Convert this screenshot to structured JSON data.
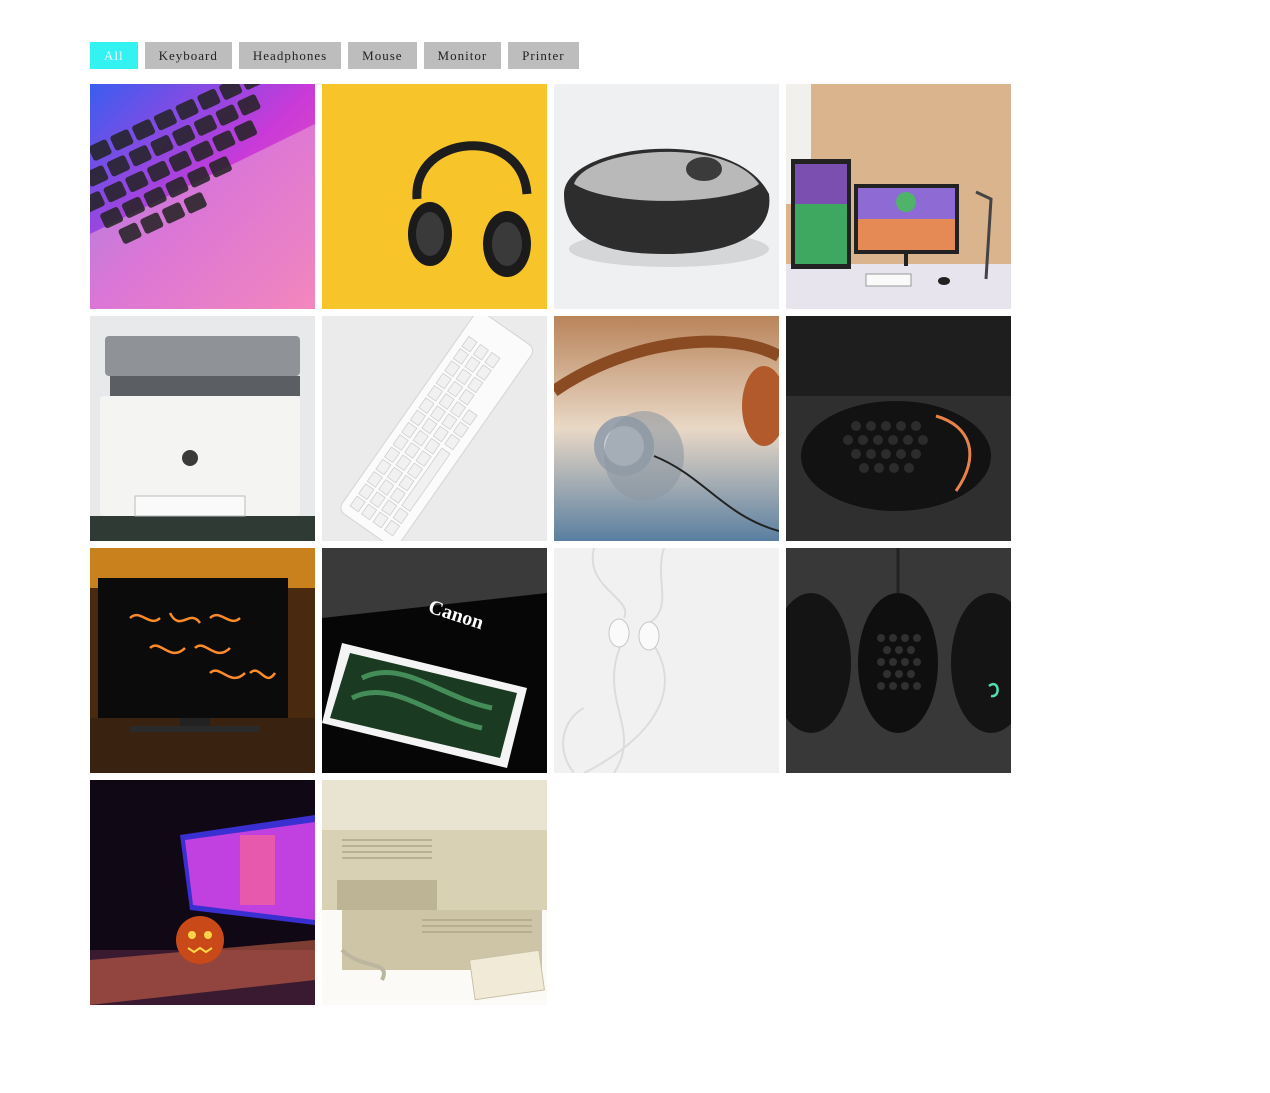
{
  "filters": [
    {
      "label": "All",
      "active": true
    },
    {
      "label": "Keyboard",
      "active": false
    },
    {
      "label": "Headphones",
      "active": false
    },
    {
      "label": "Mouse",
      "active": false
    },
    {
      "label": "Monitor",
      "active": false
    },
    {
      "label": "Printer",
      "active": false
    }
  ],
  "colors": {
    "active_filter": "#33f2f2",
    "inactive_filter": "#bdbdbd"
  },
  "gallery": [
    {
      "category": "Keyboard",
      "icon": "keyboard-photo"
    },
    {
      "category": "Headphones",
      "icon": "headphones-photo"
    },
    {
      "category": "Mouse",
      "icon": "mouse-photo"
    },
    {
      "category": "Monitor",
      "icon": "monitor-photo"
    },
    {
      "category": "Printer",
      "icon": "printer-photo"
    },
    {
      "category": "Keyboard",
      "icon": "keyboard-photo"
    },
    {
      "category": "Headphones",
      "icon": "headphones-photo"
    },
    {
      "category": "Mouse",
      "icon": "mouse-photo"
    },
    {
      "category": "Monitor",
      "icon": "monitor-photo",
      "caption": "good vibes only"
    },
    {
      "category": "Printer",
      "icon": "printer-photo",
      "brand": "Canon"
    },
    {
      "category": "Headphones",
      "icon": "earphones-photo"
    },
    {
      "category": "Mouse",
      "icon": "mouse-photo"
    },
    {
      "category": "Monitor",
      "icon": "monitor-photo"
    },
    {
      "category": "Printer",
      "icon": "printer-photo"
    }
  ]
}
